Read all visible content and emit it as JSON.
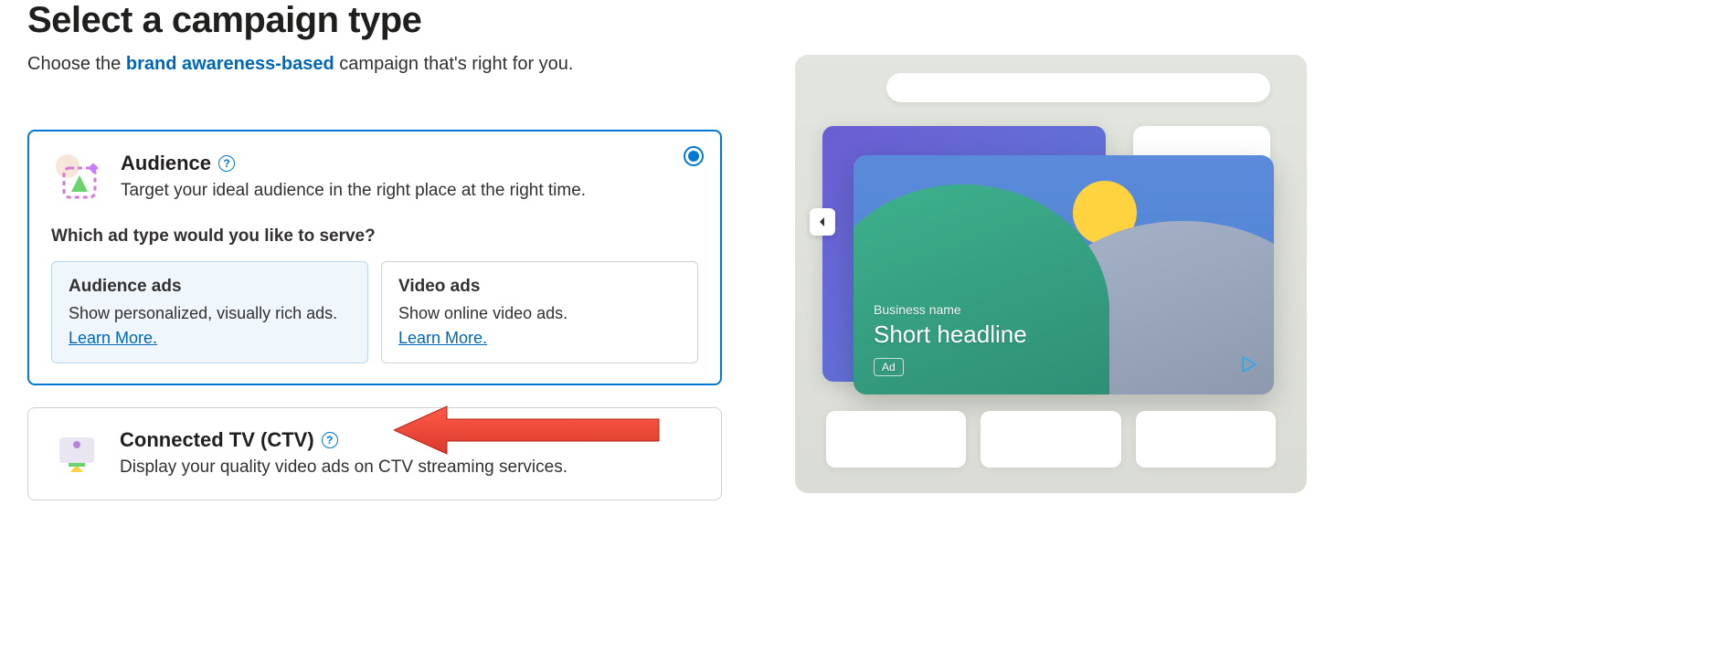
{
  "header": {
    "title": "Select a campaign type",
    "subtitle_prefix": "Choose the ",
    "subtitle_highlight": "brand awareness-based",
    "subtitle_suffix": " campaign that's right for you."
  },
  "campaigns": {
    "audience": {
      "title": "Audience",
      "description": "Target your ideal audience in the right place at the right time.",
      "question": "Which ad type would you like to serve?",
      "selected": true,
      "ad_types": [
        {
          "title": "Audience ads",
          "description": "Show personalized, visually rich ads.",
          "learn_more": "Learn More.",
          "selected": true
        },
        {
          "title": "Video ads",
          "description": "Show online video ads.",
          "learn_more": "Learn More.",
          "selected": false
        }
      ]
    },
    "ctv": {
      "title": "Connected TV (CTV)",
      "description": "Display your quality video ads on CTV streaming services."
    }
  },
  "preview": {
    "business_name": "Business name",
    "headline": "Short headline",
    "ad_label": "Ad"
  },
  "help_glyph": "?"
}
